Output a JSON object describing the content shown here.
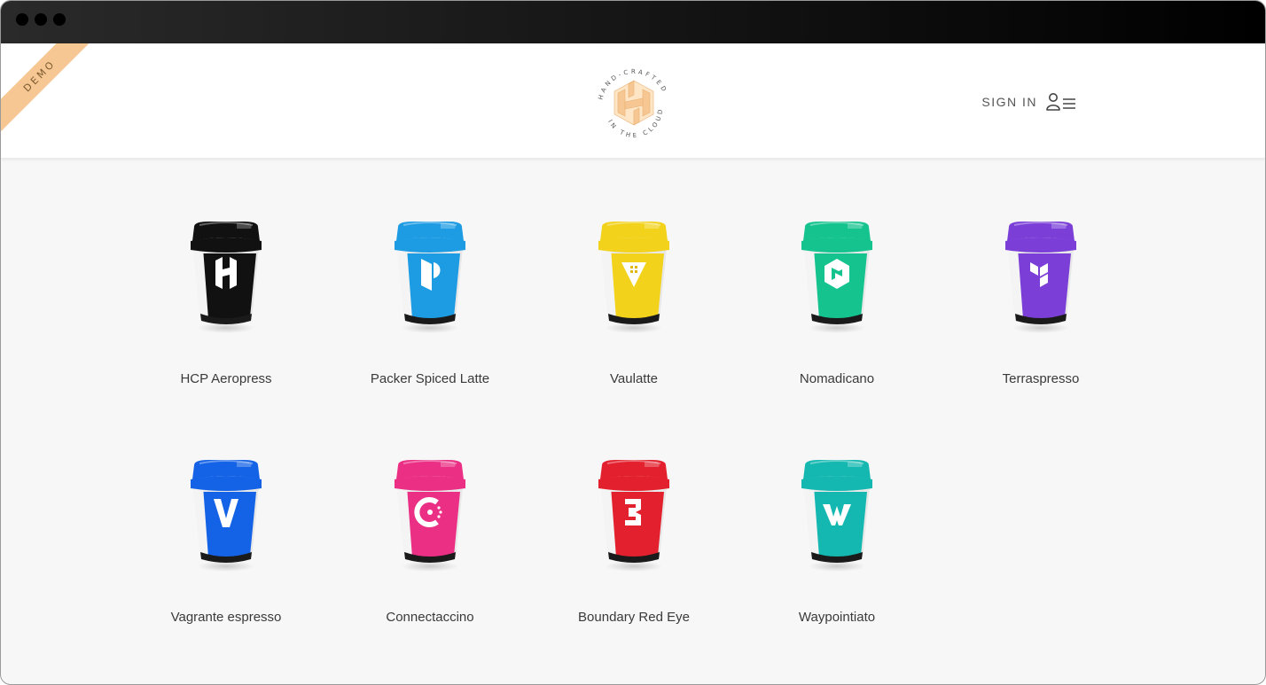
{
  "browser": {
    "title": ""
  },
  "header": {
    "demo_ribbon": "DEMO",
    "logo_text_top": "HAND-CRAFTED",
    "logo_text_bottom": "IN THE CLOUDS",
    "sign_in_label": "SIGN IN"
  },
  "products": [
    {
      "name": "HCP Aeropress",
      "color": "#111111",
      "icon": "hashicorp-logo-icon"
    },
    {
      "name": "Packer Spiced Latte",
      "color": "#1d9be3",
      "icon": "packer-logo-icon"
    },
    {
      "name": "Vaulatte",
      "color": "#f2d21b",
      "icon": "vault-logo-icon"
    },
    {
      "name": "Nomadicano",
      "color": "#14c38e",
      "icon": "nomad-logo-icon"
    },
    {
      "name": "Terraspresso",
      "color": "#7b3fd8",
      "icon": "terraform-logo-icon"
    },
    {
      "name": "Vagrante espresso",
      "color": "#1463e6",
      "icon": "vagrant-logo-icon"
    },
    {
      "name": "Connectaccino",
      "color": "#ea2f85",
      "icon": "consul-logo-icon"
    },
    {
      "name": "Boundary Red Eye",
      "color": "#e3202d",
      "icon": "boundary-logo-icon"
    },
    {
      "name": "Waypointiato",
      "color": "#15b8b0",
      "icon": "waypoint-logo-icon"
    }
  ],
  "colors": {
    "ribbon": "#f6c793",
    "logo": "#f6c793",
    "page_background": "#f7f7f7"
  }
}
